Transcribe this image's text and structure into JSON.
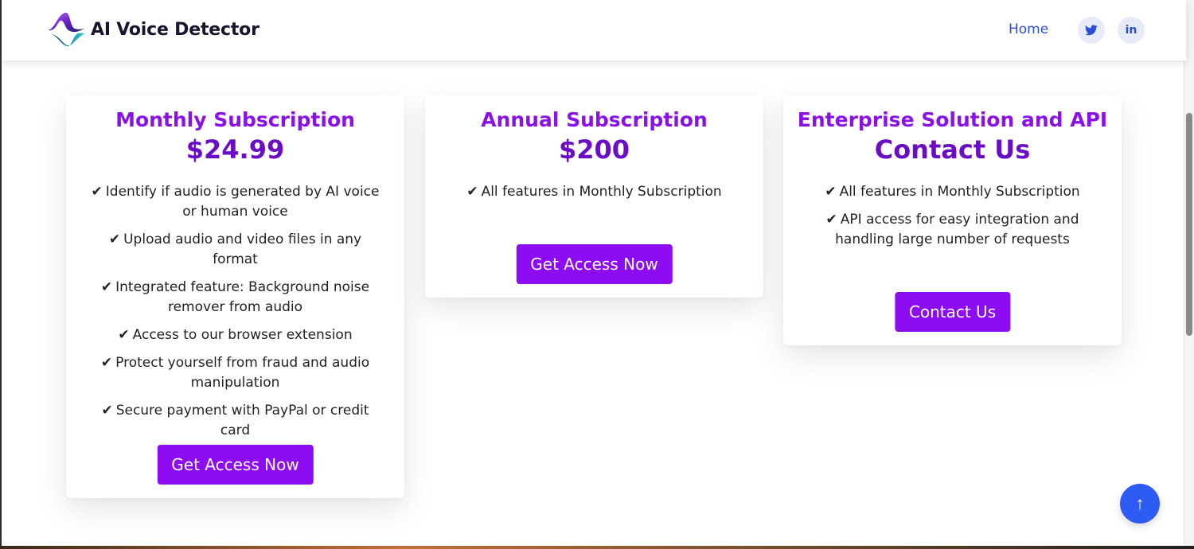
{
  "header": {
    "brand_name": "AI Voice Detector",
    "nav": {
      "home_label": "Home"
    },
    "social": {
      "twitter_icon": "twitter-icon",
      "linkedin_label": "in"
    }
  },
  "cards": [
    {
      "title": "Monthly Subscription",
      "price": "$24.99",
      "features": [
        "Identify if audio is generated by AI voice or human voice",
        "Upload audio and video files in any format",
        "Integrated feature: Background noise remover from audio",
        "Access to our browser extension",
        "Protect yourself from fraud and audio manipulation",
        "Secure payment with PayPal or credit card"
      ],
      "button_label": "Get Access Now"
    },
    {
      "title": "Annual Subscription",
      "price": "$200",
      "features": [
        "All features in Monthly Subscription"
      ],
      "button_label": "Get Access Now"
    },
    {
      "title": "Enterprise Solution and API",
      "price": "Contact Us",
      "features": [
        "All features in Monthly Subscription",
        "API access for easy integration and handling large number of requests"
      ],
      "button_label": "Contact Us"
    }
  ],
  "colors": {
    "accent_purple": "#8d0cf2",
    "title_purple": "#8a12e6",
    "price_purple": "#6a0dc4",
    "link_blue": "#2a4fd6",
    "scroll_top_blue": "#2f5bf5"
  },
  "icons": {
    "check": "check-icon",
    "scroll_top": "arrow-up-icon"
  }
}
